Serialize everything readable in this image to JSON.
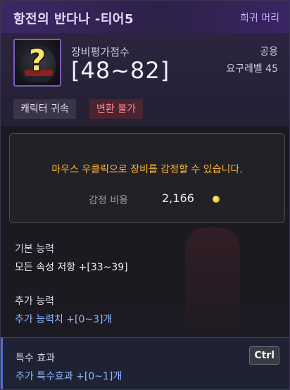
{
  "item": {
    "name": "항전의 반다나 -티어5",
    "rarity": "희귀 머리"
  },
  "stats": {
    "score_label": "장비평가점수",
    "score_value": "[48~82]",
    "class": "공용",
    "level_req": "요구레벨 45"
  },
  "tags": {
    "bind": "캐릭터 귀속",
    "trade": "변환 불가"
  },
  "appraise": {
    "message": "마우스 우클릭으로 장비를 감정할 수 있습니다.",
    "cost_label": "감정 비용",
    "cost_value": "2,166",
    "coin_icon": "gold-coin-icon"
  },
  "sections": {
    "basic_title": "기본 능력",
    "basic_line": "모든 속성 저항 +[33~39]",
    "extra_title": "추가 능력",
    "extra_line": "추가 능력치 +[0~3]개",
    "special_title": "특수 효과",
    "special_line": "추가 특수효과 +[0~1]개"
  },
  "keyhint": {
    "label": "Ctrl"
  },
  "colors": {
    "accent_purple": "#3d2766",
    "rarity_text": "#c9a8ff",
    "gold_text": "#ffb438",
    "warn_red": "#ff8b8b",
    "blue_text": "#8fb8ff"
  }
}
